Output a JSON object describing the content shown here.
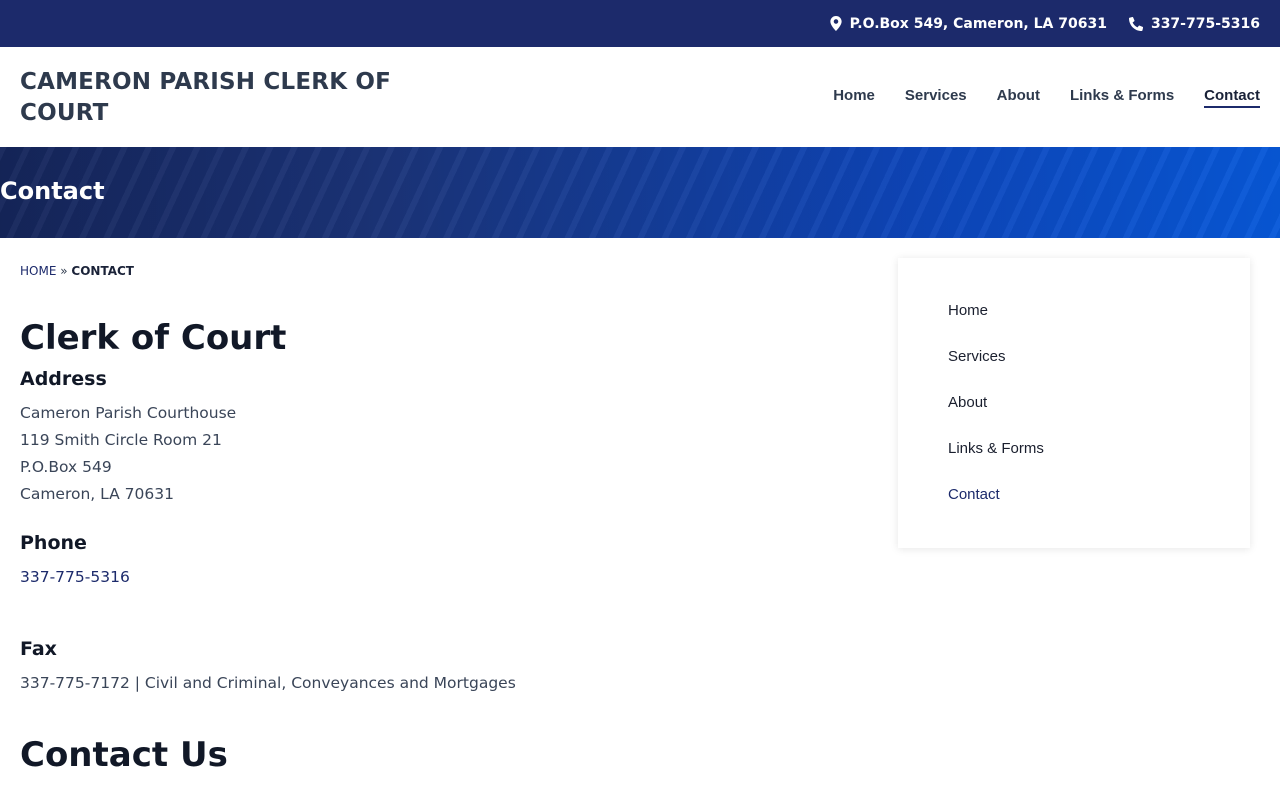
{
  "topbar": {
    "address": "P.O.Box 549, Cameron, LA 70631",
    "phone": "337-775-5316",
    "address_icon": "map-pin-icon",
    "phone_icon": "phone-icon",
    "bg_color": "#1c2a6b"
  },
  "header": {
    "site_title": "CAMERON PARISH CLERK OF COURT",
    "nav": [
      {
        "label": "Home"
      },
      {
        "label": "Services"
      },
      {
        "label": "About"
      },
      {
        "label": "Links & Forms"
      },
      {
        "label": "Contact",
        "active": true
      }
    ]
  },
  "hero": {
    "title": "Contact"
  },
  "breadcrumb": {
    "home": "HOME",
    "separator": "»",
    "current": "CONTACT"
  },
  "main": {
    "heading": "Clerk of Court",
    "address_heading": "Address",
    "address_lines": [
      "Cameron Parish Courthouse",
      "119 Smith Circle Room 21",
      "P.O.Box 549",
      "Cameron, LA 70631"
    ],
    "phone_heading": "Phone",
    "phone": "337-775-5316",
    "fax_heading": "Fax",
    "fax": "337-775-7172 | Civil and Criminal, Conveyances and Mortgages",
    "contact_heading": "Contact Us"
  },
  "sidebar": {
    "items": [
      {
        "label": "Home"
      },
      {
        "label": "Services"
      },
      {
        "label": "About"
      },
      {
        "label": "Links & Forms"
      },
      {
        "label": "Contact",
        "active": true
      }
    ]
  },
  "colors": {
    "navy": "#1c2a6b",
    "text": "#2e3a4d",
    "hero_start": "#15255a",
    "hero_end": "#0758d9"
  }
}
